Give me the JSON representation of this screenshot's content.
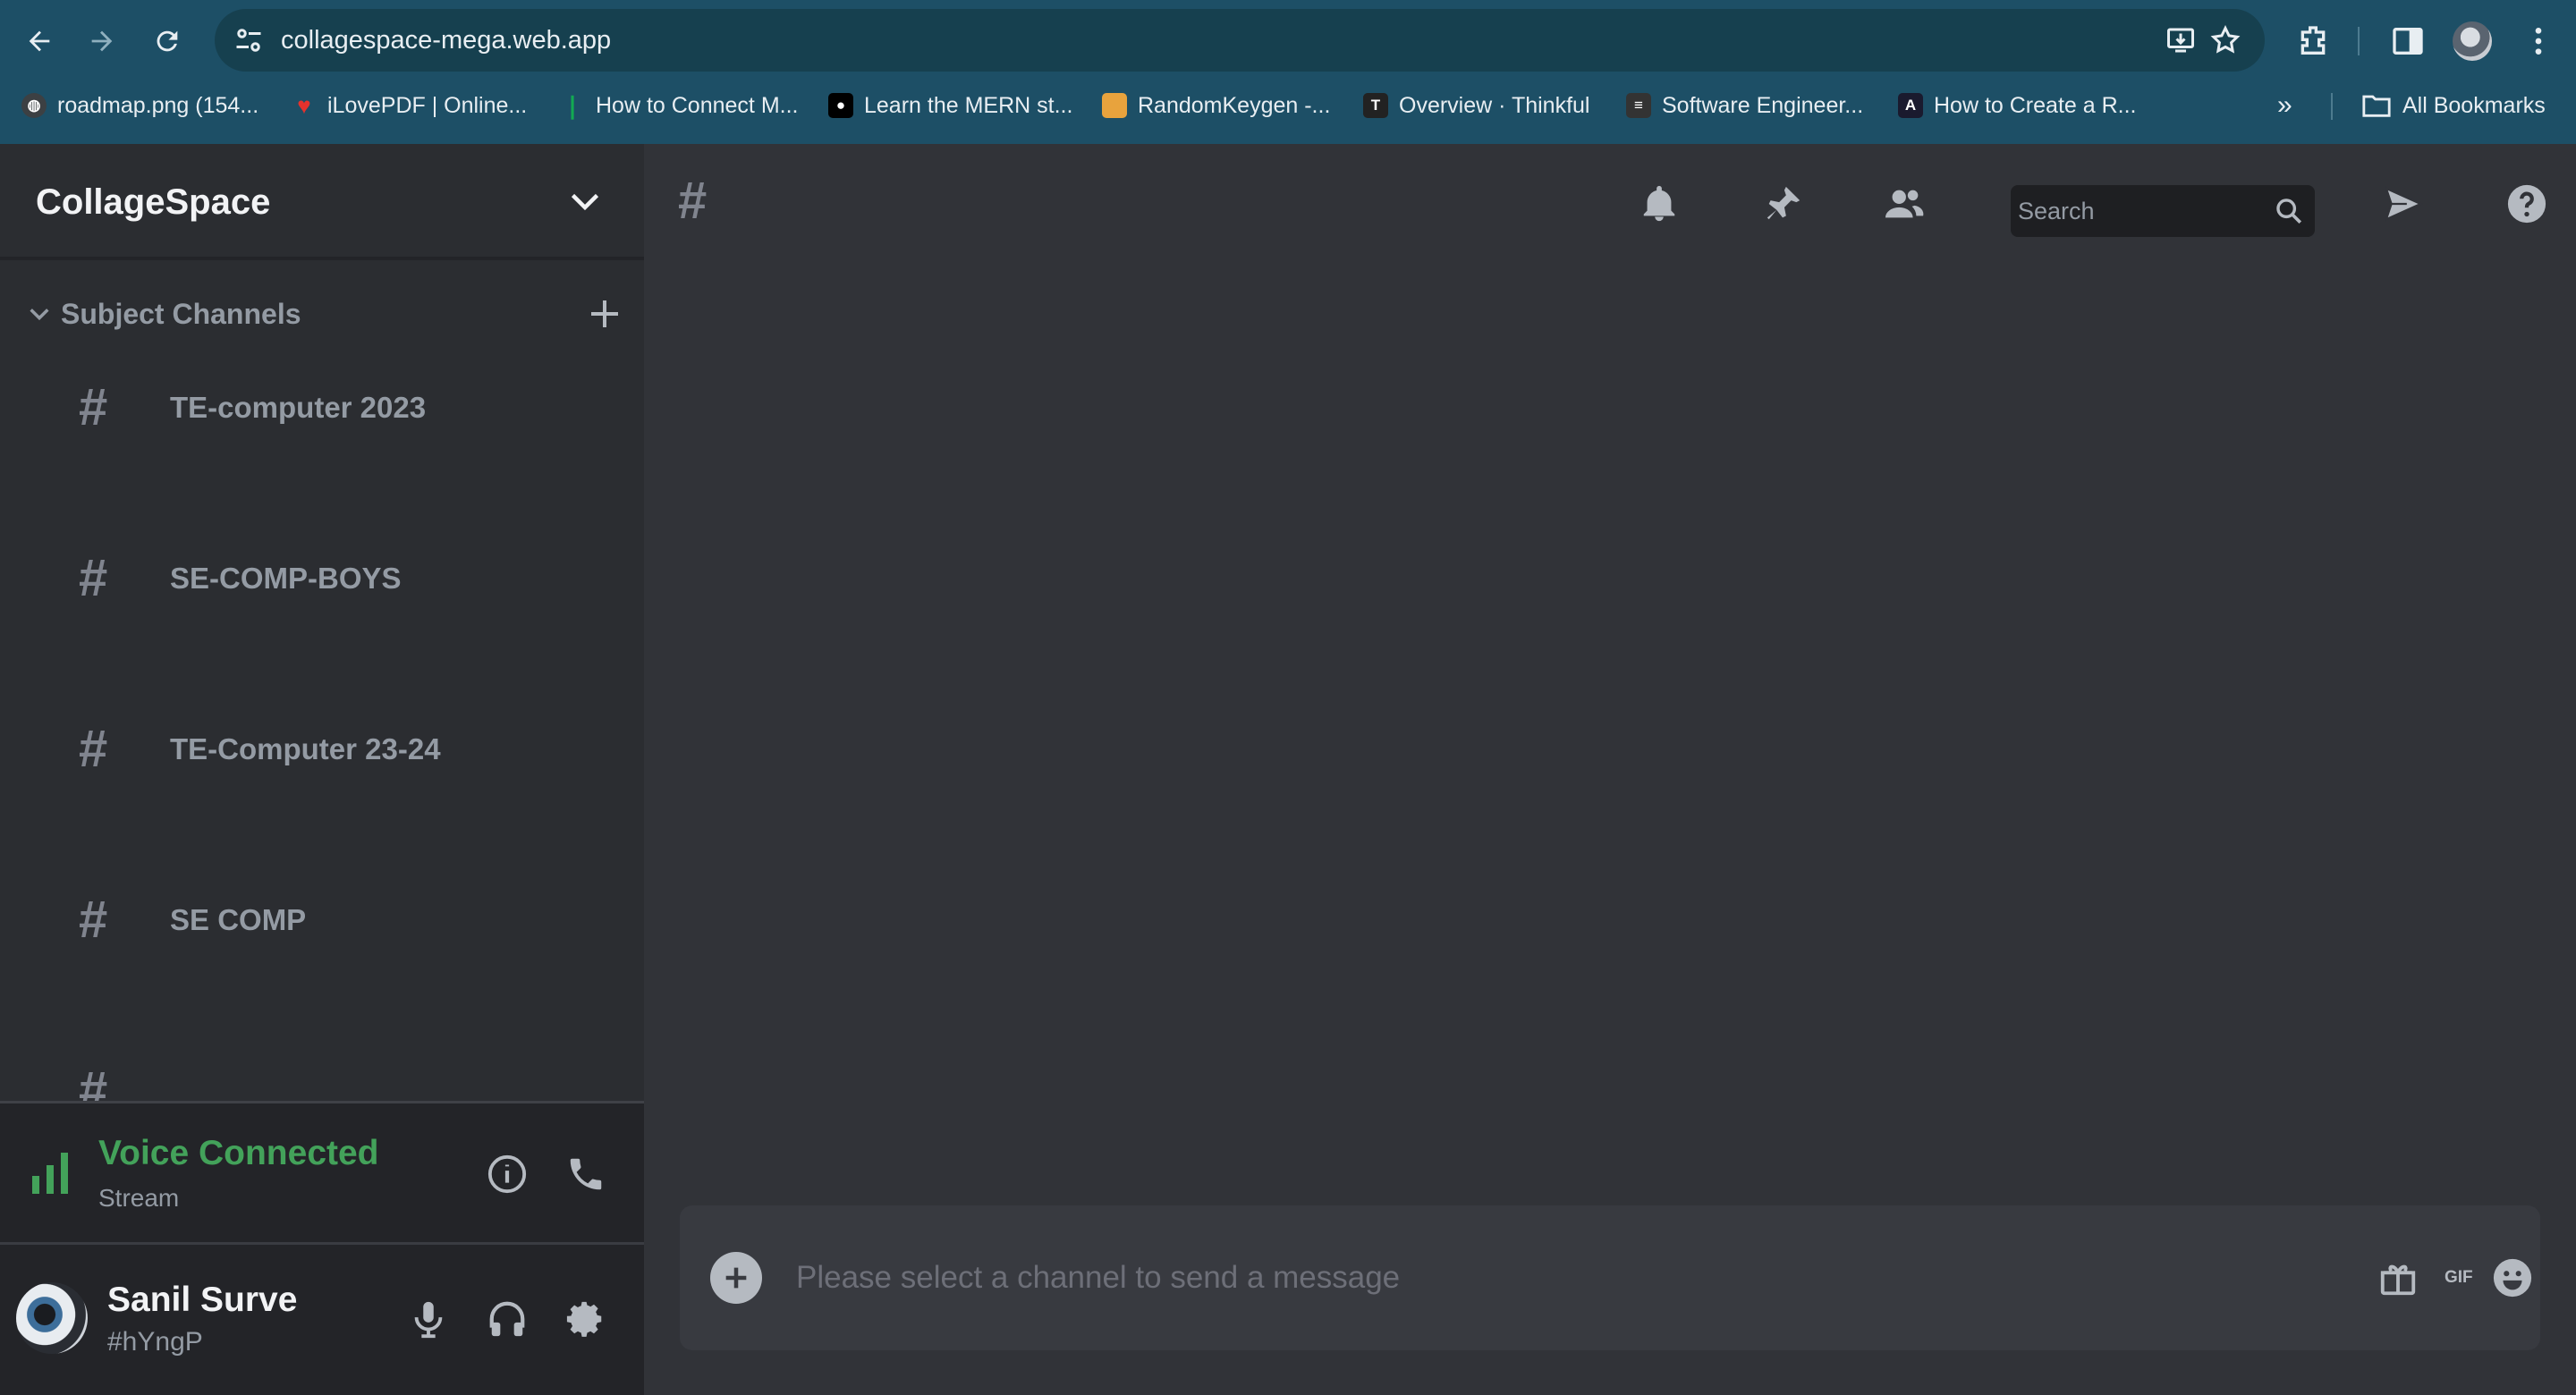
{
  "browser": {
    "url": "collagespace-mega.web.app",
    "bookmarks": [
      {
        "label": "roadmap.png (154...",
        "icon": "globe-icon",
        "color": "#3c4043"
      },
      {
        "label": "iLovePDF | Online...",
        "icon": "heart-icon",
        "color": "#e5322d"
      },
      {
        "label": "How to Connect M...",
        "icon": "leaf-icon",
        "color": "#13aa52"
      },
      {
        "label": "Learn the MERN st...",
        "icon": "medium-icon",
        "color": "#000000"
      },
      {
        "label": "RandomKeygen -...",
        "icon": "key-icon",
        "color": "#e8a33d"
      },
      {
        "label": "Overview · Thinkful",
        "icon": "thinkful-icon",
        "color": "#222222"
      },
      {
        "label": "Software Engineer...",
        "icon": "doc-icon",
        "color": "#333333"
      },
      {
        "label": "How to Create a R...",
        "icon": "angular-icon",
        "color": "#1a1a2e"
      }
    ],
    "all_bookmarks_label": "All Bookmarks",
    "overflow_label": "»"
  },
  "server": {
    "name": "CollageSpace",
    "category": "Subject Channels",
    "channels": [
      {
        "name": "TE-computer 2023"
      },
      {
        "name": "SE-COMP-BOYS"
      },
      {
        "name": "TE-Computer 23-24"
      },
      {
        "name": "SE COMP"
      }
    ],
    "hash_symbol": "#"
  },
  "voice": {
    "status": "Voice Connected",
    "channel": "Stream",
    "status_color": "#43a25a"
  },
  "user": {
    "name": "Sanil Surve",
    "tag": "#hYngP"
  },
  "main": {
    "hash_symbol": "#",
    "search_placeholder": "Search",
    "message_placeholder": "Please select a channel to send a message",
    "gif_label": "GIF"
  },
  "colors": {
    "chrome": "#1d4f66",
    "sidebar": "#2b2d31",
    "main": "#313338",
    "composer": "#383a40"
  }
}
